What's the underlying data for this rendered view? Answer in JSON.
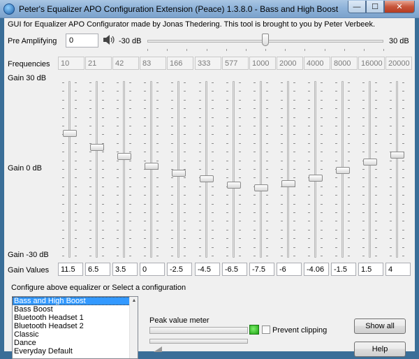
{
  "window": {
    "title": "Peter's Equalizer APO Configuration Extension (Peace) 1.3.8.0 - Bass and High Boost",
    "min_glyph": "—",
    "max_glyph": "☐",
    "close_glyph": "✕"
  },
  "info_text": "GUI for Equalizer APO Configurator made by Jonas Thedering. This tool is brought to you by Peter Verbeek.",
  "pre_amp": {
    "label": "Pre Amplifying",
    "value": "0",
    "min_label": "-30 dB",
    "max_label": "30 dB",
    "level_fraction": 0.5
  },
  "frequencies_label": "Frequencies",
  "gain_top_label": "Gain 30 dB",
  "gain_zero_label": "Gain 0 dB",
  "gain_bottom_label": "Gain -30 dB",
  "gain_values_label": "Gain Values",
  "bands": [
    {
      "freq": "10",
      "gain": "11.5",
      "gain_db": 11.5
    },
    {
      "freq": "21",
      "gain": "6.5",
      "gain_db": 6.5
    },
    {
      "freq": "42",
      "gain": "3.5",
      "gain_db": 3.5
    },
    {
      "freq": "83",
      "gain": "0",
      "gain_db": 0
    },
    {
      "freq": "166",
      "gain": "-2.5",
      "gain_db": -2.5
    },
    {
      "freq": "333",
      "gain": "-4.5",
      "gain_db": -4.5
    },
    {
      "freq": "577",
      "gain": "-6.5",
      "gain_db": -6.5
    },
    {
      "freq": "1000",
      "gain": "-7.5",
      "gain_db": -7.5
    },
    {
      "freq": "2000",
      "gain": "-6",
      "gain_db": -6
    },
    {
      "freq": "4000",
      "gain": "-4.06",
      "gain_db": -4.06
    },
    {
      "freq": "8000",
      "gain": "-1.5",
      "gain_db": -1.5
    },
    {
      "freq": "16000",
      "gain": "1.5",
      "gain_db": 1.5
    },
    {
      "freq": "20000",
      "gain": "4",
      "gain_db": 4
    }
  ],
  "config_label": "Configure above equalizer or Select a configuration",
  "configurations": [
    "Bass and High Boost",
    "Bass Boost",
    "Bluetooth Headset 1",
    "Bluetooth Headset 2",
    "Classic",
    "Dance",
    "Everyday Default"
  ],
  "selected_configuration": "Bass and High Boost",
  "peak_meter_label": "Peak value meter",
  "prevent_clipping_label": "Prevent clipping",
  "prevent_clipping_checked": false,
  "show_all_label": "Show all",
  "help_label": "Help",
  "icons": {
    "app": "peace-app-icon",
    "speaker": "speaker-icon",
    "led": "peak-led-icon"
  }
}
